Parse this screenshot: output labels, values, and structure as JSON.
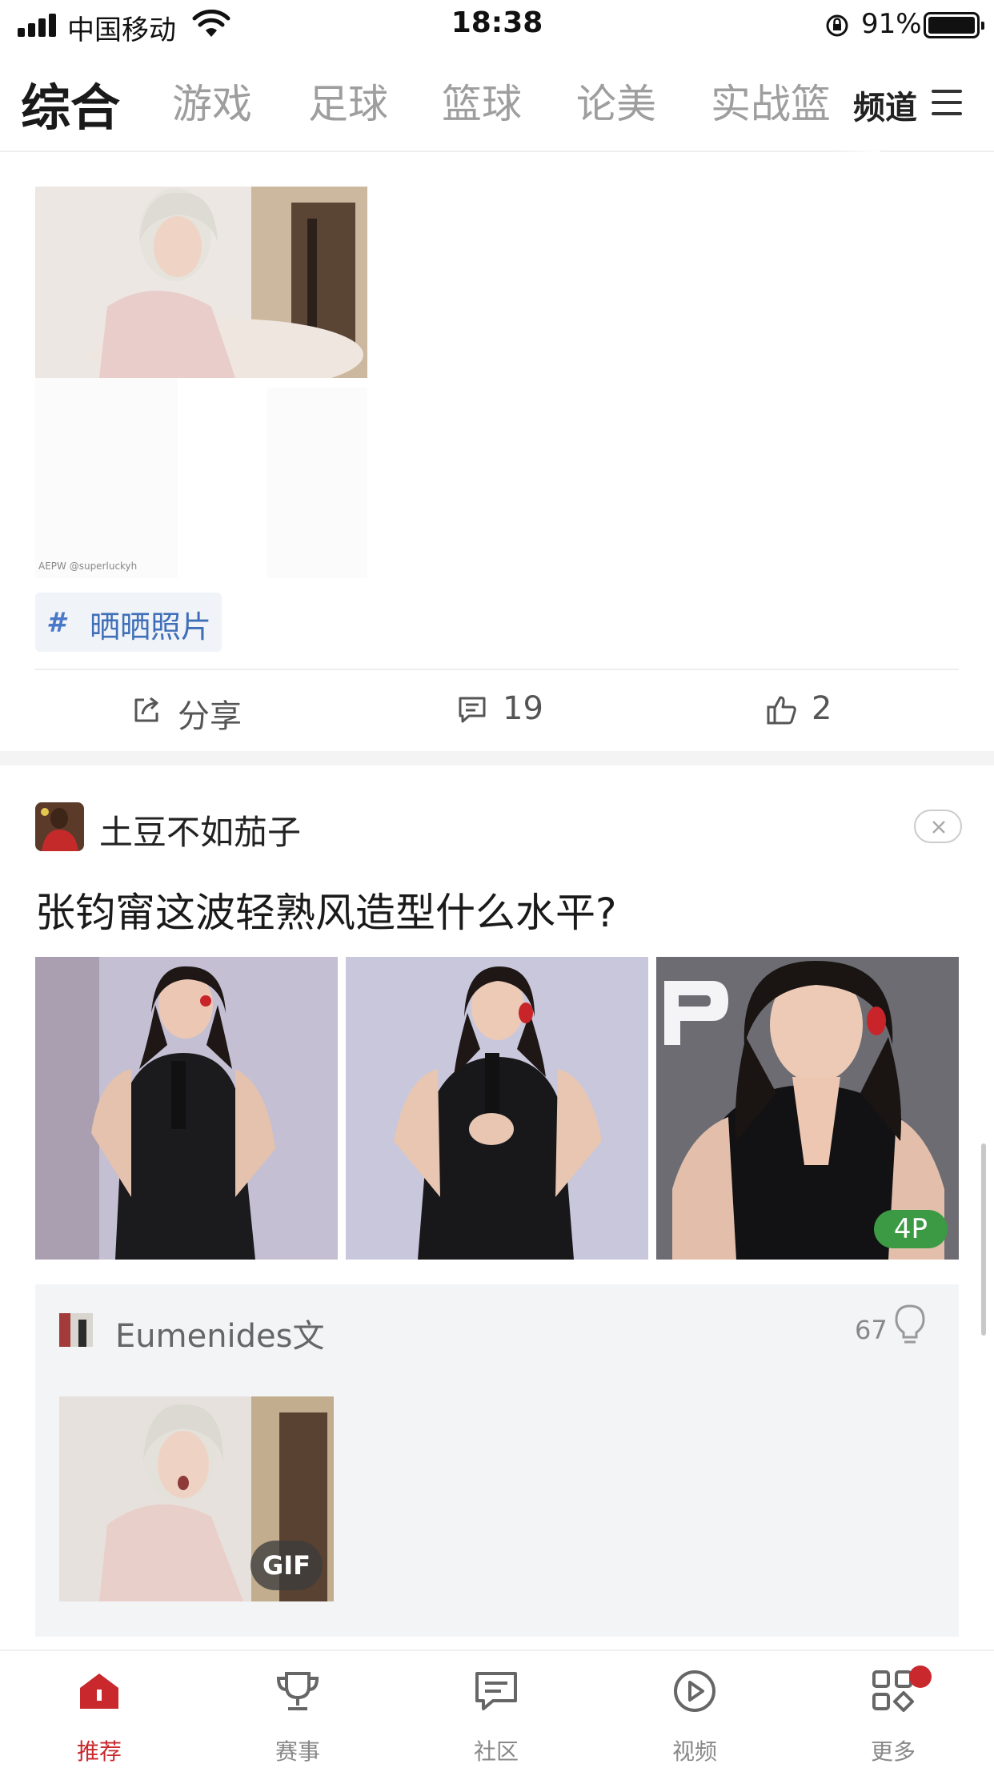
{
  "status_bar": {
    "carrier": "中国移动",
    "time": "18:38",
    "battery_percent": "91%"
  },
  "tabs": {
    "items": [
      {
        "label": "综合",
        "active": true
      },
      {
        "label": "游戏"
      },
      {
        "label": "足球"
      },
      {
        "label": "篮球"
      },
      {
        "label": "论美"
      },
      {
        "label": "实战篮"
      }
    ],
    "channel_label": "频道"
  },
  "post1": {
    "watermark": "AEPW @superluckyh",
    "topic_icon": "#",
    "topic": "晒晒照片",
    "actions": {
      "share_label": "分享",
      "comments": "19",
      "likes": "2"
    }
  },
  "post2": {
    "author": "土豆不如茄子",
    "title": "张钧甯这波轻熟风造型什么水平?",
    "photo_count": "4P",
    "comment": {
      "author": "Eumenides文",
      "light_count": "67",
      "gif_badge": "GIF"
    }
  },
  "bottom_nav": {
    "items": [
      {
        "label": "推荐",
        "icon": "home-icon",
        "active": true
      },
      {
        "label": "赛事",
        "icon": "trophy-icon"
      },
      {
        "label": "社区",
        "icon": "chat-icon"
      },
      {
        "label": "视频",
        "icon": "play-icon"
      },
      {
        "label": "更多",
        "icon": "grid-icon",
        "badge": true
      }
    ]
  },
  "colors": {
    "accent": "#c9282d",
    "topic_blue": "#3f6fb8",
    "photo_badge_green": "#3c9a45"
  }
}
